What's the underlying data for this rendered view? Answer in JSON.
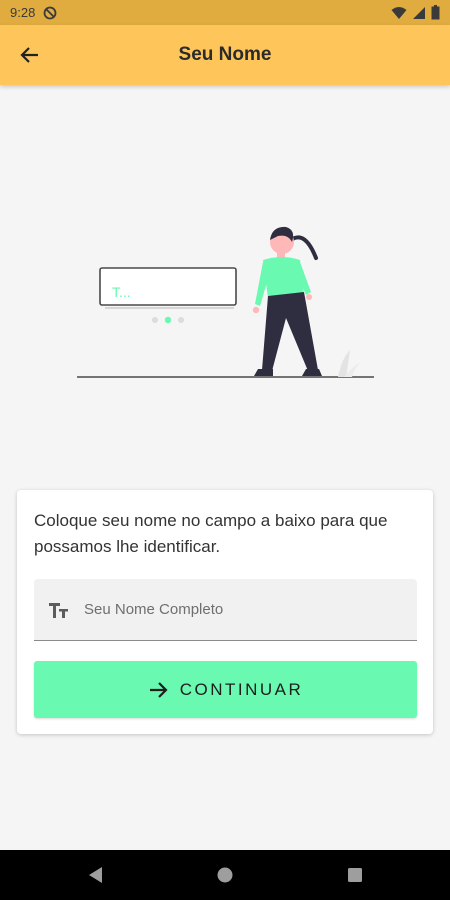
{
  "status_bar": {
    "time": "9:28",
    "icons": [
      "do-not-disturb-icon",
      "wifi-icon",
      "signal-icon",
      "battery-icon"
    ]
  },
  "app_bar": {
    "title": "Seu Nome",
    "back_icon": "arrow-back-icon",
    "color": "#fec65a"
  },
  "illustration": {
    "input_text": "T..."
  },
  "form": {
    "instruction": "Coloque seu nome no campo a baixo para que possamos lhe identificar.",
    "name_field": {
      "icon": "text-format-icon",
      "placeholder": "Seu Nome Completo",
      "value": ""
    },
    "continue_button": {
      "label": "CONTINUAR",
      "icon": "arrow-forward-icon",
      "color": "#69f9b0"
    }
  },
  "nav_bar": {
    "buttons": [
      "back-triangle-icon",
      "home-circle-icon",
      "recents-square-icon"
    ]
  }
}
